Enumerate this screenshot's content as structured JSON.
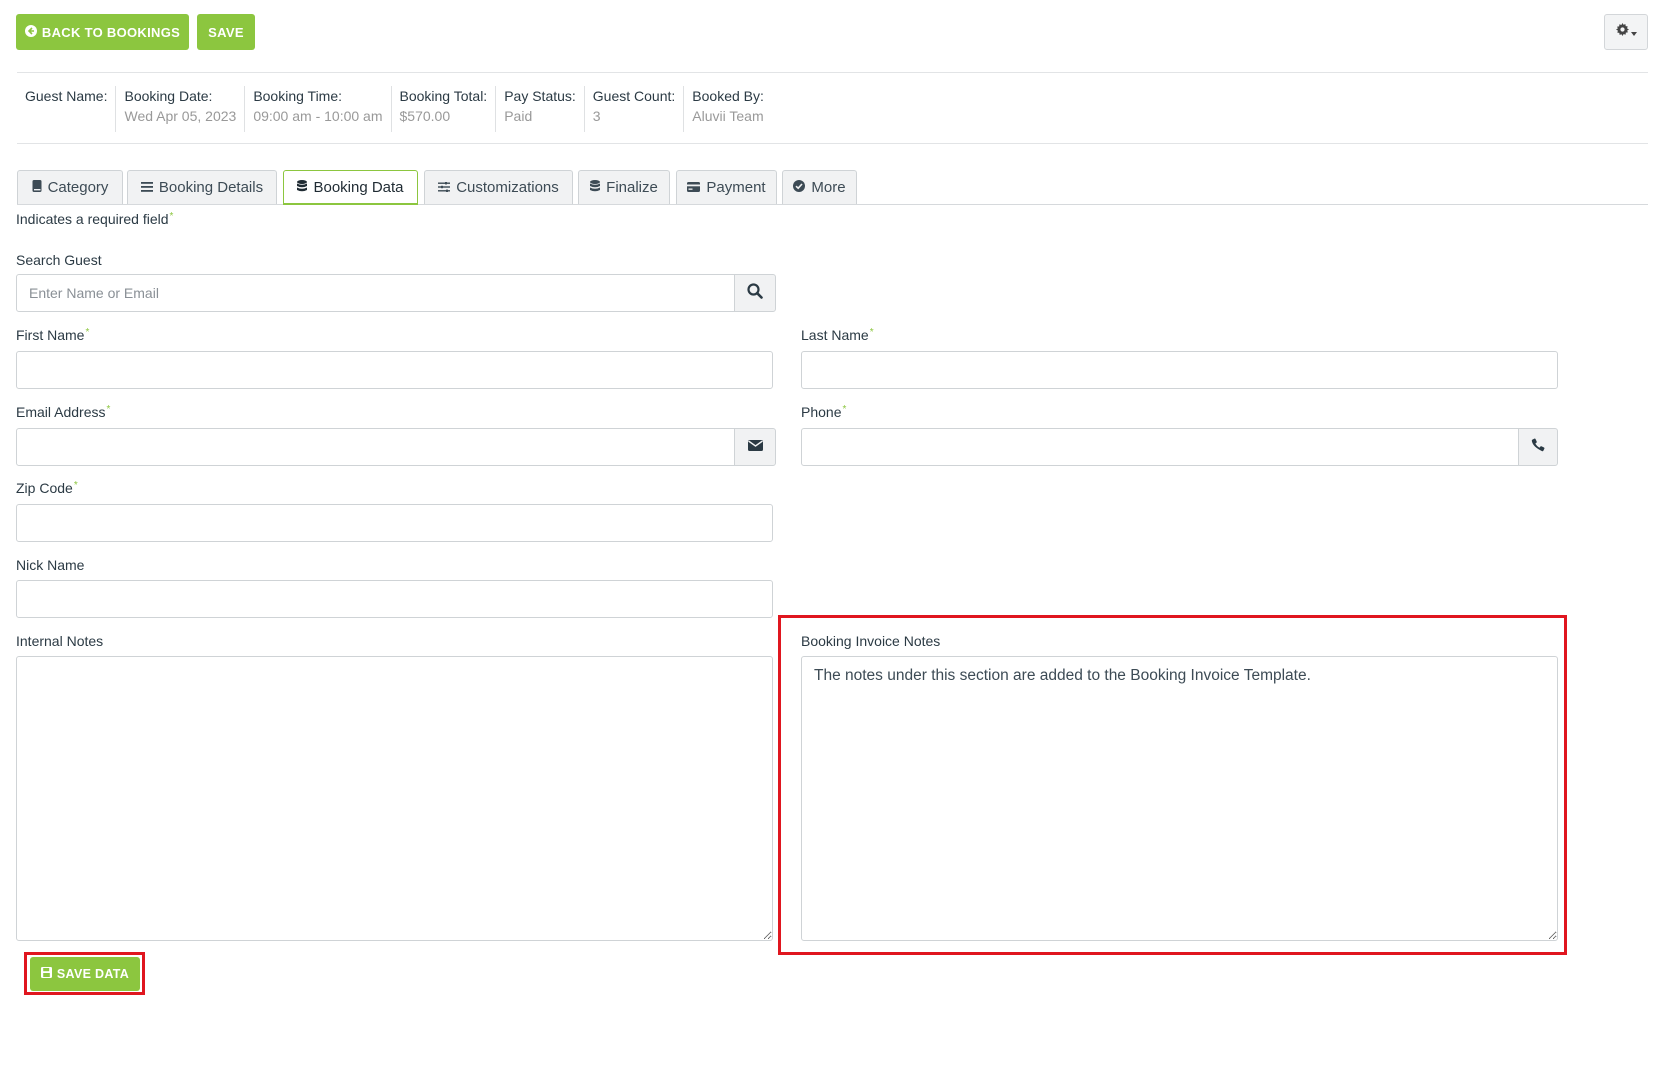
{
  "toolbar": {
    "back_label": "BACK TO BOOKINGS",
    "save_label": "SAVE"
  },
  "summary": [
    {
      "label": "Guest Name:",
      "value": ""
    },
    {
      "label": "Booking Date:",
      "value": "Wed Apr 05, 2023"
    },
    {
      "label": "Booking Time:",
      "value": "09:00 am - 10:00 am"
    },
    {
      "label": "Booking Total:",
      "value": "$570.00"
    },
    {
      "label": "Pay Status:",
      "value": "Paid"
    },
    {
      "label": "Guest Count:",
      "value": "3"
    },
    {
      "label": "Booked By:",
      "value": "Aluvii Team"
    }
  ],
  "tabs": [
    {
      "label": "Category",
      "icon": "book-icon"
    },
    {
      "label": "Booking Details",
      "icon": "list-icon"
    },
    {
      "label": "Booking Data",
      "icon": "database-icon",
      "active": true
    },
    {
      "label": "Customizations",
      "icon": "sliders-icon"
    },
    {
      "label": "Finalize",
      "icon": "database-icon"
    },
    {
      "label": "Payment",
      "icon": "credit-card-icon"
    },
    {
      "label": "More",
      "icon": "check-circle-icon"
    }
  ],
  "form": {
    "required_note": "Indicates a required field",
    "search_label": "Search Guest",
    "search_placeholder": "Enter Name or Email",
    "first_name_label": "First Name",
    "last_name_label": "Last Name",
    "email_label": "Email Address",
    "phone_label": "Phone",
    "zip_label": "Zip Code",
    "nick_label": "Nick Name",
    "internal_notes_label": "Internal Notes",
    "invoice_notes_label": "Booking Invoice Notes",
    "invoice_notes_value": "The notes under this section are added to the Booking Invoice Template.",
    "save_data_label": "SAVE DATA"
  },
  "colors": {
    "accent": "#8cc63f",
    "highlight": "#e0161f"
  }
}
